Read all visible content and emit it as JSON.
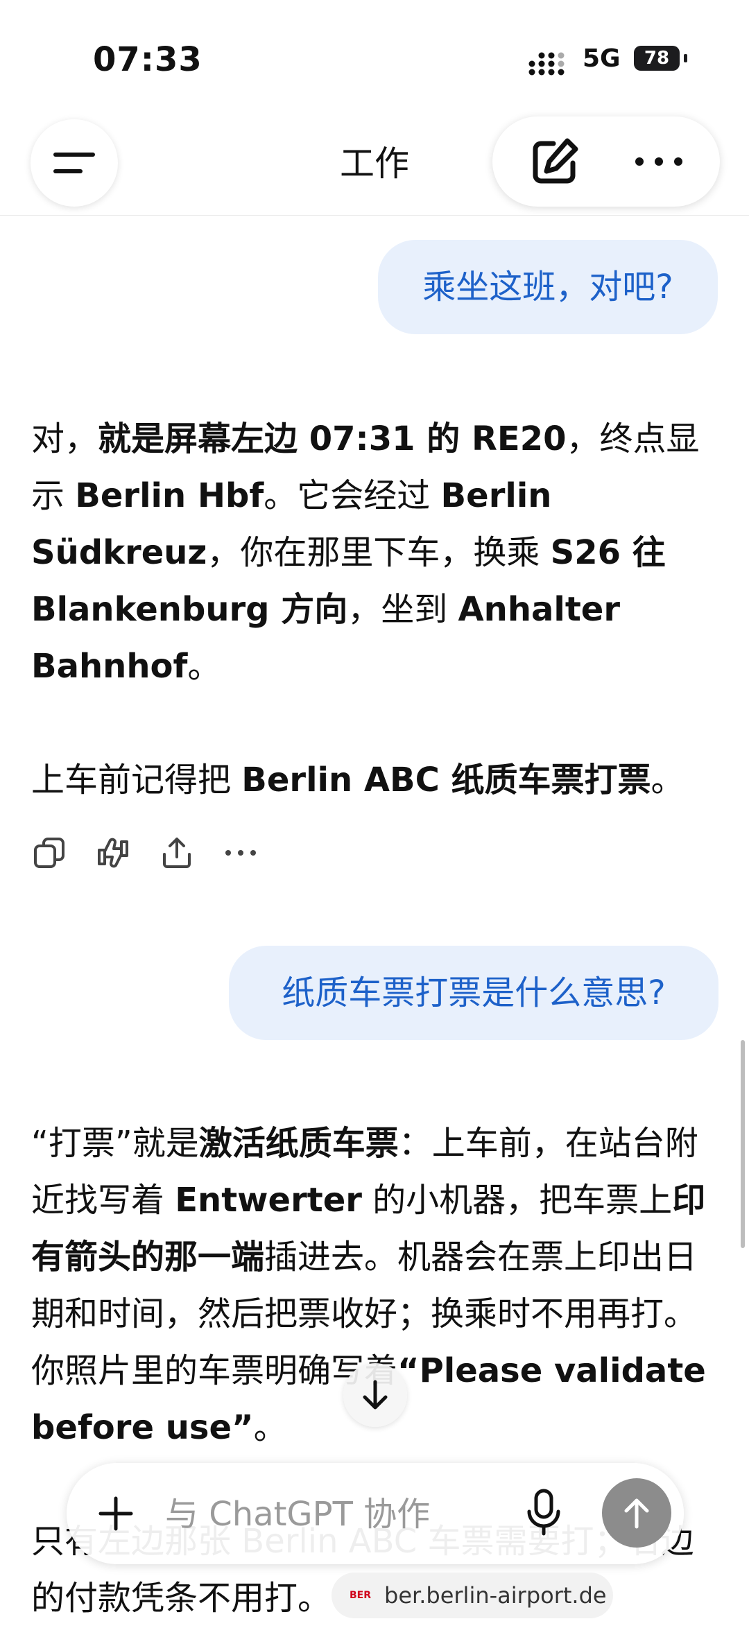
{
  "status_bar": {
    "time": "07:33",
    "network": "5G",
    "battery": "78"
  },
  "header": {
    "title": "工作",
    "menu_icon": "hamburger-icon",
    "compose_icon": "compose-icon",
    "more_icon": "more-horizontal-icon"
  },
  "messages": {
    "user_1": "乘坐这班，对吧?",
    "answer_1": {
      "p1": {
        "a": "对，",
        "b": "就是屏幕左边 07:31 的 RE20",
        "c": "，终点显示 ",
        "d": "Berlin Hbf",
        "e": "。它会经过 ",
        "f": "Berlin Südkreuz",
        "g": "，你在那里下车，换乘 ",
        "h": "S26 往 Blankenburg 方向",
        "i": "，坐到 ",
        "j": "Anhalter Bahnhof",
        "k": "。"
      },
      "p2": {
        "a": "上车前记得把 ",
        "b": "Berlin ABC 纸质车票打票",
        "c": "。"
      }
    },
    "user_2": "纸质车票打票是什么意思?",
    "answer_2": {
      "p1": {
        "a": "“打票”就是",
        "b": "激活纸质车票",
        "c": "：上车前，在站台附近找写着 ",
        "d": "Entwerter",
        "e": " 的小机器，把车票上",
        "f": "印有箭头的那一端",
        "g": "插进去。机器会在票上印出日期和时间，然后把票收好；换乘时不用再打。你照片里的车票明确写着",
        "h": "“Please validate before use”",
        "i": "。"
      },
      "p2": "只有左边那张 Berlin ABC 车票需要打；右边的付款凭条不用打。"
    }
  },
  "composer": {
    "placeholder": "与 ChatGPT 协作"
  },
  "url_bar": {
    "badge": "BER",
    "url": "ber.berlin-airport.de"
  }
}
